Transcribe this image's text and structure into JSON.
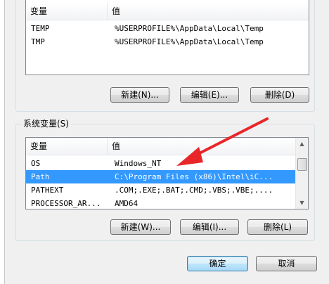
{
  "user_vars": {
    "columns": {
      "name": "变量",
      "value": "值"
    },
    "rows": [
      {
        "name": "TEMP",
        "value": "%USERPROFILE%\\AppData\\Local\\Temp"
      },
      {
        "name": "TMP",
        "value": "%USERPROFILE%\\AppData\\Local\\Temp"
      }
    ],
    "buttons": {
      "new": "新建(N)...",
      "edit": "编辑(E)...",
      "delete": "删除(D)"
    }
  },
  "system_vars": {
    "legend": "系统变量(S)",
    "columns": {
      "name": "变量",
      "value": "值"
    },
    "rows": [
      {
        "name": "OS",
        "value": "Windows_NT"
      },
      {
        "name": "Path",
        "value": "C:\\Program Files (x86)\\Intel\\iC...",
        "selected": true
      },
      {
        "name": "PATHEXT",
        "value": ".COM;.EXE;.BAT;.CMD;.VBS;.VBE;...."
      },
      {
        "name": "PROCESSOR_AR...",
        "value": "AMD64"
      }
    ],
    "buttons": {
      "new": "新建(W)...",
      "edit": "编辑(I)...",
      "delete": "删除(L)"
    }
  },
  "dialog": {
    "ok": "确定",
    "cancel": "取消"
  },
  "colors": {
    "selection": "#3399ff",
    "annotation_arrow": "#e8262a"
  },
  "icons": {
    "scroll_up": "scroll-up-arrow-icon",
    "scroll_down": "scroll-down-arrow-icon",
    "annotation": "red-arrow-annotation"
  }
}
